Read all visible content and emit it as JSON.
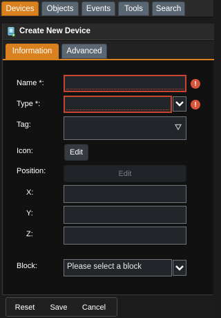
{
  "top_tabs": [
    {
      "label": "Devices",
      "active": true
    },
    {
      "label": "Objects",
      "active": false
    },
    {
      "label": "Events",
      "active": false
    },
    {
      "label": "Tools",
      "active": false
    },
    {
      "label": "Search",
      "active": false
    }
  ],
  "panel": {
    "title": "Create New Device",
    "icon": "device-add-icon"
  },
  "sub_tabs": [
    {
      "label": "Information",
      "active": true
    },
    {
      "label": "Advanced",
      "active": false
    }
  ],
  "form": {
    "name_label": "Name *:",
    "name_value": "",
    "type_label": "Type *:",
    "type_value": "",
    "tag_label": "Tag:",
    "tag_value": "",
    "icon_label": "Icon:",
    "icon_edit": "Edit",
    "position_label": "Position:",
    "position_edit": "Edit",
    "x_label": "X:",
    "x_value": "",
    "y_label": "Y:",
    "y_value": "",
    "z_label": "Z:",
    "z_value": "",
    "block_label": "Block:",
    "block_value": "Please select a block",
    "error_icon": "!"
  },
  "footer": {
    "reset": "Reset",
    "save": "Save",
    "cancel": "Cancel"
  },
  "colors": {
    "accent": "#d9811f",
    "tab_inactive": "#5b6673",
    "error": "#c8462d",
    "field_bg": "#22262a"
  }
}
